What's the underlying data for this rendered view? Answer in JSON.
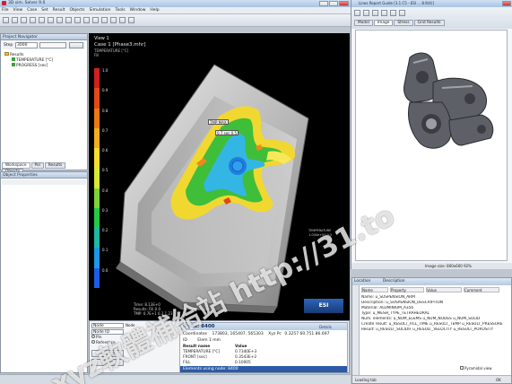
{
  "app": {
    "title": "3D sim. Solver 9.0",
    "menu": [
      "File",
      "View",
      "Case",
      "Set",
      "Result",
      "Objects",
      "Simulation",
      "Tools",
      "Window",
      "Help"
    ],
    "toolbar_icons": [
      "new-icon",
      "open-icon",
      "save-icon",
      "print-icon",
      "undo-icon",
      "redo-icon",
      "zoom-icon",
      "rotate-icon",
      "pan-icon",
      "fit-icon",
      "mesh-icon",
      "result-icon",
      "play-icon",
      "stop-icon",
      "settings-icon"
    ]
  },
  "project_navigator": {
    "header": "Project Navigator",
    "filter_value": "3000",
    "tree": [
      "Results",
      "TEMPERATURE [°C]",
      "PROGRESS [sec]"
    ],
    "tabs": [
      "Workspace",
      "Pol",
      "Results",
      "Objects"
    ]
  },
  "object_properties": {
    "header": "Object Properties"
  },
  "viewport": {
    "view_label": "View 1",
    "case_label": "Case 1 [Phase3.mhr]",
    "sub_label": "TEMPERATURE [°C]",
    "sub_label2": "Fill",
    "legend_values": [
      "1.0",
      "0.9",
      "0.8",
      "0.7",
      "0.6",
      "0.5",
      "0.4",
      "0.3",
      "0.2",
      "0.1",
      "0.0"
    ],
    "legend_colors": [
      "#d02020",
      "#e04a1a",
      "#ea7a16",
      "#f2ad20",
      "#f4dd2c",
      "#d8e836",
      "#7ed23a",
      "#26c84a",
      "#20b8a0",
      "#1c98e6",
      "#1e5ce8"
    ],
    "callouts": [
      "TMP:MAX",
      "0.7 sec 0.5"
    ],
    "bottom_info": [
      "Time: 8.13E+0",
      "Results: Fill 0.0",
      "TMP: 0.7E+1  6.3  1.23"
    ],
    "corner_badge": "ESI",
    "inset_caption": [
      "TEMPERATURE",
      "1.000e+00 0.5"
    ]
  },
  "node_panel": {
    "type_label": "Node",
    "select_value": "Node",
    "input_value": "Node ID",
    "option1": "Pin",
    "option2": "Reference",
    "search_button": "Search",
    "close_button": "Close",
    "title": "Node: 8400",
    "extra_link": "Details",
    "coord_label": "Coordinates",
    "coord_value": "173803, 165407, 565303",
    "xyz_label": "Xyz Pc",
    "xyz_value": "0.3257  60.751  86.697",
    "unit_label": "ID",
    "unit_value": "Elem 1 mm",
    "result_header": "Result name",
    "value_header": "Value",
    "result_rows": [
      [
        "TEMPERATURE [°C]",
        "0.7340E+3"
      ],
      [
        "FRONT [sec]",
        "0.3543E+2"
      ],
      [
        "FILL",
        "0.10005"
      ]
    ],
    "footer": "Elements using node: 8400"
  },
  "viewer": {
    "title": "Lines Report Guide [3.1 C5 - ESI ... 8.9(4)]",
    "tabs": [
      "Model",
      "Image",
      "Stress",
      "Grid Results"
    ],
    "status": "Image size: 800x600  92%"
  },
  "bottom_right": {
    "tabs": [
      "Location",
      "Description"
    ],
    "grid_headers": [
      "Name",
      "Property",
      "Value",
      "Comment"
    ],
    "log_lines": [
      "Name: u_SUSPENSION_ARM",
      "Description: u_SUSPENSION_DESCRIPTION",
      "Material: ALUMINIUM_A356",
      "Type: u_MESH_TYPE_TETRAHEDRAL",
      "Num. elements: u_NUM_ELEMS  u_NUM_NODES  u_NUM_SOLID",
      "Create result: u_RESULT_FILL_TIME  u_RESULT_TEMP  u_RESULT_PRESSURE",
      "Result: u_RESULT_SOLIDIF  u_RESULT_VELOCITY  u_RESULT_POROSITY"
    ],
    "checkbox_label": "Pyramidal view",
    "status_left": "Loading tab",
    "status_right": "OK"
  },
  "watermark": {
    "line1": "xyz軟體補給站 http://31.to"
  }
}
